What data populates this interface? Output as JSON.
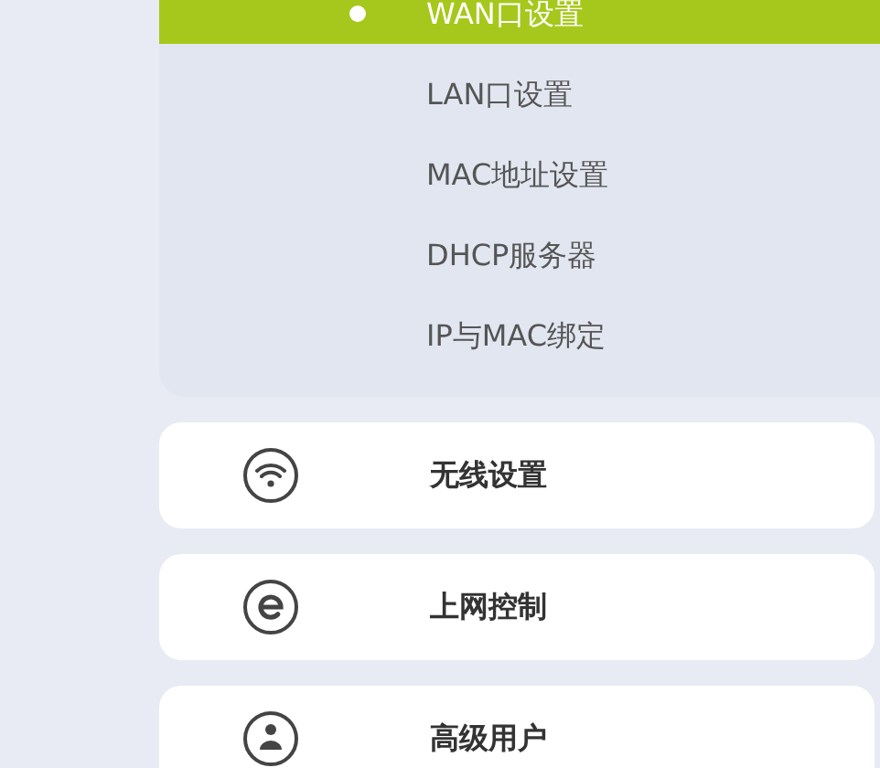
{
  "submenu": {
    "items": [
      {
        "label": "WAN口设置",
        "selected": true
      },
      {
        "label": "LAN口设置",
        "selected": false
      },
      {
        "label": "MAC地址设置",
        "selected": false
      },
      {
        "label": "DHCP服务器",
        "selected": false
      },
      {
        "label": "IP与MAC绑定",
        "selected": false
      }
    ]
  },
  "menu": [
    {
      "label": "无线设置",
      "kind": "wifi"
    },
    {
      "label": "上网控制",
      "kind": "internet"
    },
    {
      "label": "高级用户",
      "kind": "user"
    }
  ]
}
